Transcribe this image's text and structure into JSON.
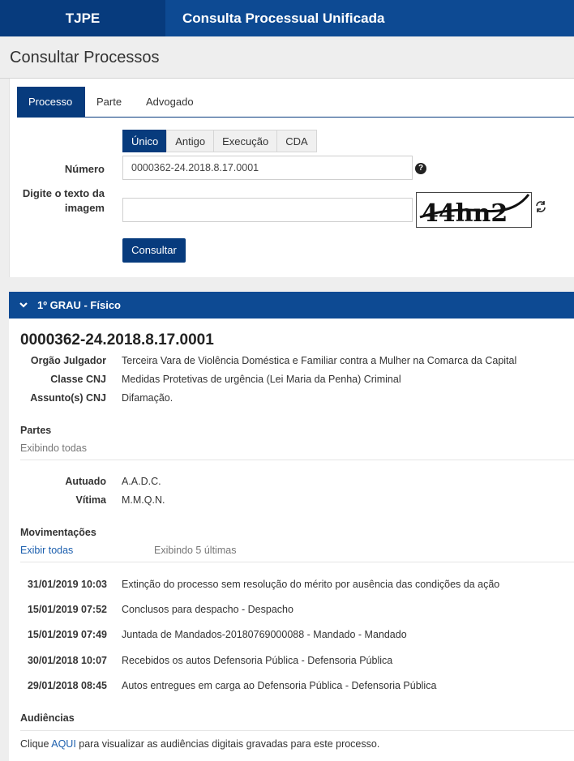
{
  "header": {
    "brand": "TJPE",
    "app_title": "Consulta Processual Unificada"
  },
  "page_title": "Consultar Processos",
  "search": {
    "tabs": [
      "Processo",
      "Parte",
      "Advogado"
    ],
    "active_tab": "Processo",
    "number_types": [
      "Único",
      "Antigo",
      "Execução",
      "CDA"
    ],
    "active_number_type": "Único",
    "numero_label": "Número",
    "numero_value": "0000362-24.2018.8.17.0001",
    "captcha_label_1": "Digite o texto da",
    "captcha_label_2": "imagem",
    "captcha_value": "",
    "captcha_text": "44hn2",
    "submit_label": "Consultar"
  },
  "result": {
    "section_title": "1º GRAU - Físico",
    "process_number": "0000362-24.2018.8.17.0001",
    "fields": [
      {
        "label": "Orgão Julgador",
        "value": "Terceira Vara de Violência Doméstica e Familiar contra a Mulher na Comarca da Capital"
      },
      {
        "label": "Classe CNJ",
        "value": "Medidas Protetivas de urgência (Lei Maria da Penha) Criminal"
      },
      {
        "label": "Assunto(s) CNJ",
        "value": "Difamação."
      }
    ],
    "partes": {
      "title": "Partes",
      "subtitle": "Exibindo todas",
      "items": [
        {
          "label": "Autuado",
          "value": "A.A.D.C."
        },
        {
          "label": "Vítima",
          "value": "M.M.Q.N."
        }
      ]
    },
    "movimentacoes": {
      "title": "Movimentações",
      "show_all_link": "Exibir todas",
      "showing_text": "Exibindo 5 últimas",
      "items": [
        {
          "date": "31/01/2019 10:03",
          "desc": "Extinção do processo sem resolução do mérito por ausência das condições da ação"
        },
        {
          "date": "15/01/2019 07:52",
          "desc": "Conclusos para despacho - Despacho"
        },
        {
          "date": "15/01/2019 07:49",
          "desc": "Juntada de Mandados-20180769000088 - Mandado - Mandado"
        },
        {
          "date": "30/01/2018 10:07",
          "desc": "Recebidos os autos Defensoria Pública - Defensoria Pública"
        },
        {
          "date": "29/01/2018 08:45",
          "desc": "Autos entregues em carga ao Defensoria Pública - Defensoria Pública"
        }
      ]
    },
    "audiencias": {
      "title": "Audiências",
      "text_before": "Clique ",
      "link": "AQUI",
      "text_after": " para visualizar as audiências digitais gravadas para este processo."
    }
  },
  "colors": {
    "primary": "#073b7d",
    "header_blue": "#0d4a93",
    "link": "#1c5fae"
  },
  "icons": [
    "question-circle-icon",
    "refresh-icon",
    "chevron-down-icon"
  ]
}
